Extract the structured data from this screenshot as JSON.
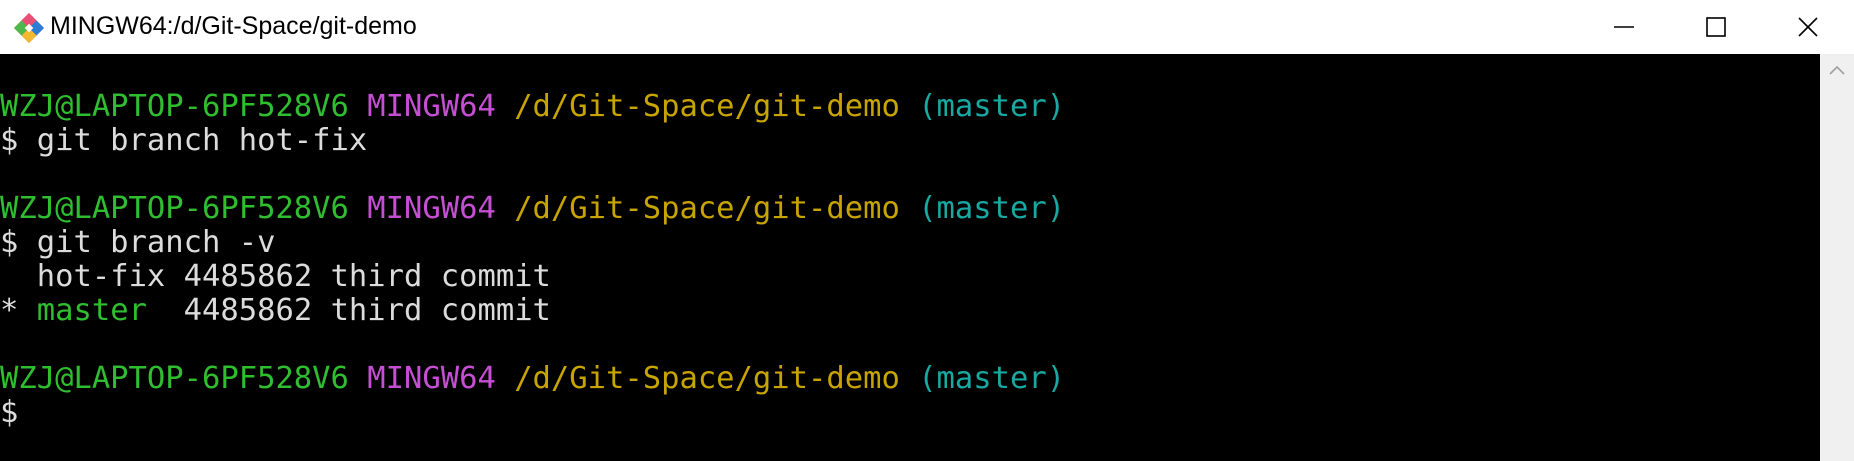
{
  "window": {
    "title": "MINGW64:/d/Git-Space/git-demo",
    "icon": "git-bash-icon",
    "controls": {
      "minimize": "minimize-icon",
      "maximize": "maximize-icon",
      "close": "close-icon"
    }
  },
  "colors": {
    "user_host": "#2fbe2f",
    "system": "#c54fd2",
    "path": "#c8a400",
    "branch": "#19a8a2",
    "text": "#dcdcdc",
    "background": "#000000"
  },
  "terminal": {
    "prompt1": {
      "user_host": "WZJ@LAPTOP-6PF528V6",
      "system": "MINGW64",
      "path": "/d/Git-Space/git-demo",
      "branch": "(master)"
    },
    "command1": "$ git branch hot-fix",
    "prompt2": {
      "user_host": "WZJ@LAPTOP-6PF528V6",
      "system": "MINGW64",
      "path": "/d/Git-Space/git-demo",
      "branch": "(master)"
    },
    "command2": "$ git branch -v",
    "branch_list": [
      {
        "marker": " ",
        "name": "hot-fix",
        "rest": " 4485862 third commit"
      },
      {
        "marker": "*",
        "name": "master",
        "rest": "  4485862 third commit"
      }
    ],
    "prompt3": {
      "user_host": "WZJ@LAPTOP-6PF528V6",
      "system": "MINGW64",
      "path": "/d/Git-Space/git-demo",
      "branch": "(master)"
    },
    "command3": "$"
  }
}
